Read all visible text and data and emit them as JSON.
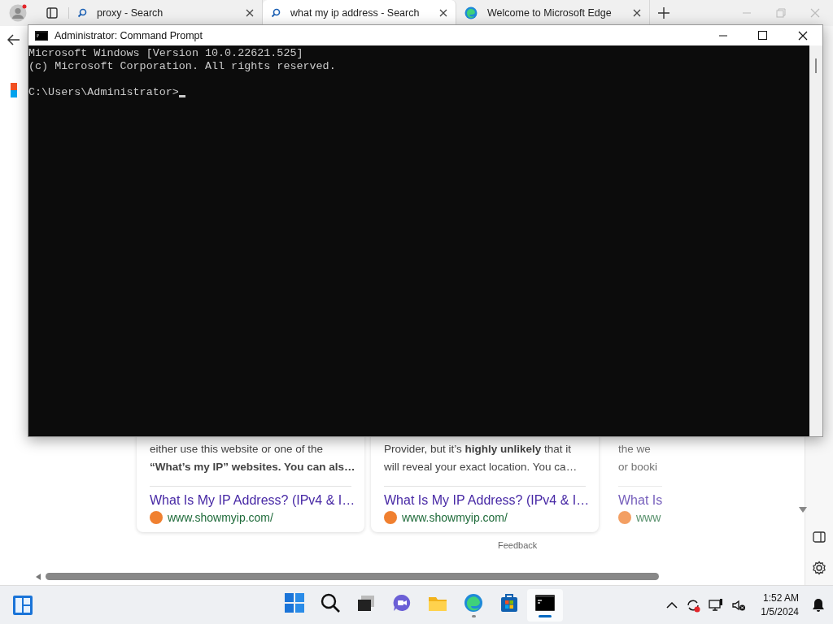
{
  "browser": {
    "tabs": [
      {
        "title": "proxy - Search",
        "kind": "search",
        "selected": false
      },
      {
        "title": "what my ip address - Search",
        "kind": "search",
        "selected": true
      },
      {
        "title": "Welcome to Microsoft Edge",
        "kind": "edge",
        "selected": false
      }
    ],
    "results": [
      {
        "lines": [
          {
            "text": "either use this website or one of the",
            "bold": false
          },
          {
            "text": "“What’s my IP” websites. You can als…",
            "bold": true
          }
        ],
        "link": "What Is My IP Address? (IPv4 & I…",
        "site": "www.showmyip.com/"
      },
      {
        "lines": [
          {
            "text": "Provider, but it’s **highly unlikely** that it",
            "bold": false
          },
          {
            "text": "will reveal your exact location. You ca…",
            "bold": false
          }
        ],
        "link": "What Is My IP Address? (IPv4 & I…",
        "site": "www.showmyip.com/"
      },
      {
        "lines": [
          {
            "text": "the we",
            "bold": false
          },
          {
            "text": "or booki",
            "bold": false
          }
        ],
        "link": "What Is",
        "site": "www"
      }
    ],
    "feedback": "Feedback"
  },
  "console": {
    "title": "Administrator: Command Prompt",
    "output": [
      "Microsoft Windows [Version 10.0.22621.525]",
      "(c) Microsoft Corporation. All rights reserved."
    ],
    "prompt": "C:\\Users\\Administrator>"
  },
  "taskbar": {
    "apps": [
      {
        "kind": "start",
        "running": false,
        "active": false
      },
      {
        "kind": "search",
        "running": false,
        "active": false
      },
      {
        "kind": "taskview",
        "running": false,
        "active": false
      },
      {
        "kind": "chat",
        "running": false,
        "active": false
      },
      {
        "kind": "files",
        "running": false,
        "active": false
      },
      {
        "kind": "edge",
        "running": true,
        "active": false
      },
      {
        "kind": "store",
        "running": false,
        "active": false
      },
      {
        "kind": "terminal",
        "running": true,
        "active": true
      }
    ],
    "time": "1:52 AM",
    "date": "1/5/2024"
  }
}
